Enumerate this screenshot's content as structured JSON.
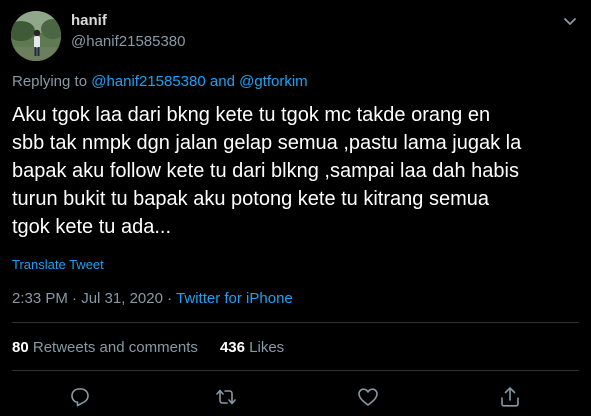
{
  "user": {
    "name": "hanif",
    "handle": "@hanif21585380"
  },
  "reply": {
    "prefix": "Replying to",
    "mention1": "@hanif21585380",
    "joiner": "and",
    "mention2": "@gtforkim"
  },
  "tweet": {
    "text": "Aku tgok laa dari bkng kete tu tgok mc takde orang en\nsbb tak nmpk dgn jalan gelap semua ,pastu lama jugak la\nbapak aku follow kete tu dari blkng ,sampai laa dah habis\nturun bukit tu bapak aku potong kete tu kitrang semua\ntgok kete tu ada...",
    "translate_label": "Translate Tweet",
    "time": "2:33 PM",
    "separator1": "·",
    "date": "Jul 31, 2020",
    "separator2": "·",
    "source": "Twitter for iPhone"
  },
  "stats": {
    "retweets_count": "80",
    "retweets_label": "Retweets and comments",
    "likes_count": "436",
    "likes_label": "Likes"
  },
  "icons": {
    "caret": "chevron-down-icon",
    "reply": "reply-icon",
    "retweet": "retweet-icon",
    "like": "heart-icon",
    "share": "share-icon"
  },
  "colors": {
    "background": "#000000",
    "accent": "#1da1f2",
    "secondary_text": "#8899a6",
    "primary_text": "#ffffff"
  }
}
